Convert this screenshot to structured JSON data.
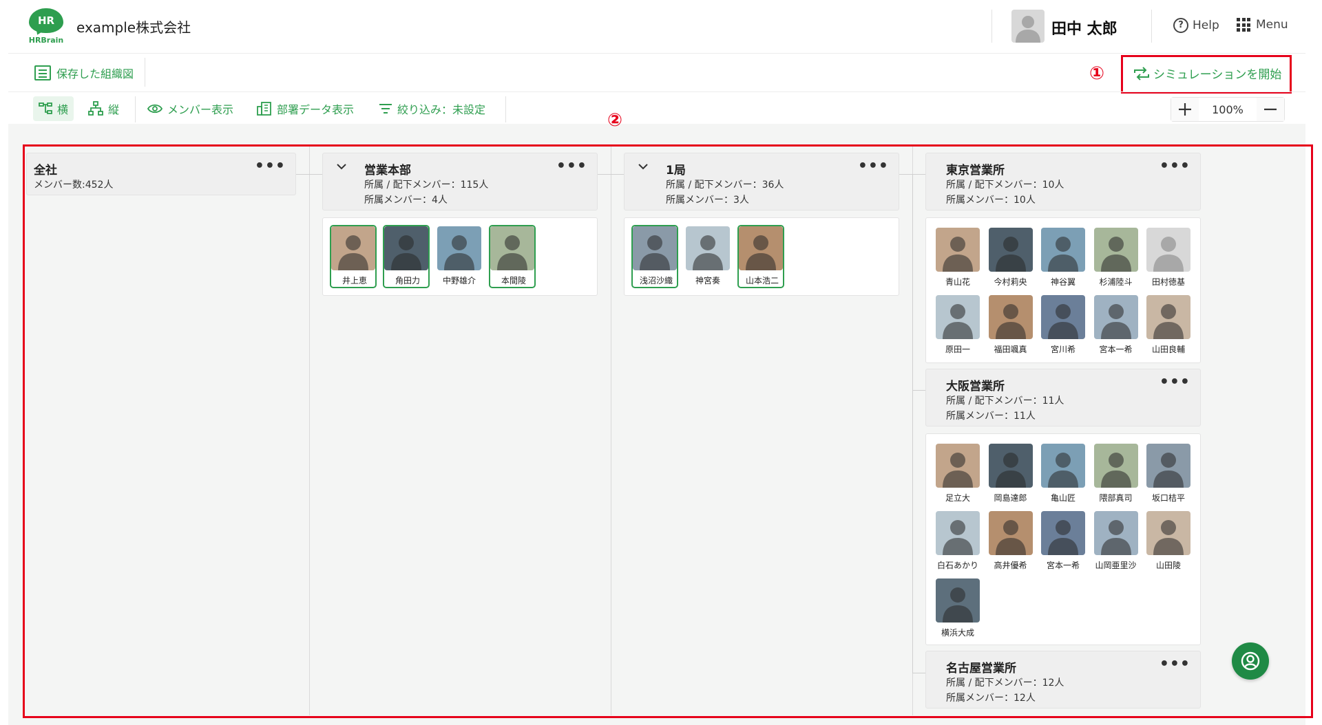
{
  "header": {
    "logo_text": "HR",
    "logo_word": "HRBrain",
    "company": "example株式会社",
    "user_name": "田中 太郎",
    "help_label": "Help",
    "menu_label": "Menu"
  },
  "toolbar": {
    "saved_chart_label": "保存した組織図",
    "simulation_label": "シミュレーションを開始",
    "annotation_1": "①",
    "annotation_2": "②",
    "horizontal_label": "横",
    "vertical_label": "縦",
    "member_view_label": "メンバー表示",
    "dept_data_label": "部署データ表示",
    "filter_label": "絞り込み：未設定",
    "zoom_value": "100%"
  },
  "org": {
    "root": {
      "name": "全社",
      "member_count": "メンバー数:452人"
    },
    "eigyo": {
      "name": "営業本部",
      "sub_members": "所属 / 配下メンバー：115人",
      "members": "所属メンバー：4人",
      "people": [
        "井上恵",
        "角田力",
        "中野雄介",
        "本間陵"
      ]
    },
    "kyoku1": {
      "name": "1局",
      "sub_members": "所属 / 配下メンバー：36人",
      "members": "所属メンバー：3人",
      "people": [
        "浅沼沙織",
        "神宮奏",
        "山本浩二"
      ]
    },
    "tokyo": {
      "name": "東京営業所",
      "sub_members": "所属 / 配下メンバー：10人",
      "members": "所属メンバー：10人",
      "people": [
        "青山花",
        "今村莉央",
        "神谷翼",
        "杉浦陸斗",
        "田村徳基",
        "原田一",
        "福田颯真",
        "宮川希",
        "宮本一希",
        "山田良輔"
      ]
    },
    "osaka": {
      "name": "大阪営業所",
      "sub_members": "所属 / 配下メンバー：11人",
      "members": "所属メンバー：11人",
      "people": [
        "足立大",
        "岡島達郎",
        "亀山匠",
        "隈部真司",
        "坂口桔平",
        "白石あかり",
        "高井優希",
        "宮本一希",
        "山岡亜里沙",
        "山田陵",
        "横浜大成"
      ]
    },
    "nagoya": {
      "name": "名古屋営業所",
      "sub_members": "所属 / 配下メンバー：12人",
      "members": "所属メンバー：12人"
    }
  },
  "colors": {
    "brand_green": "#2e9e4f",
    "annotation_red": "#e6001a"
  }
}
